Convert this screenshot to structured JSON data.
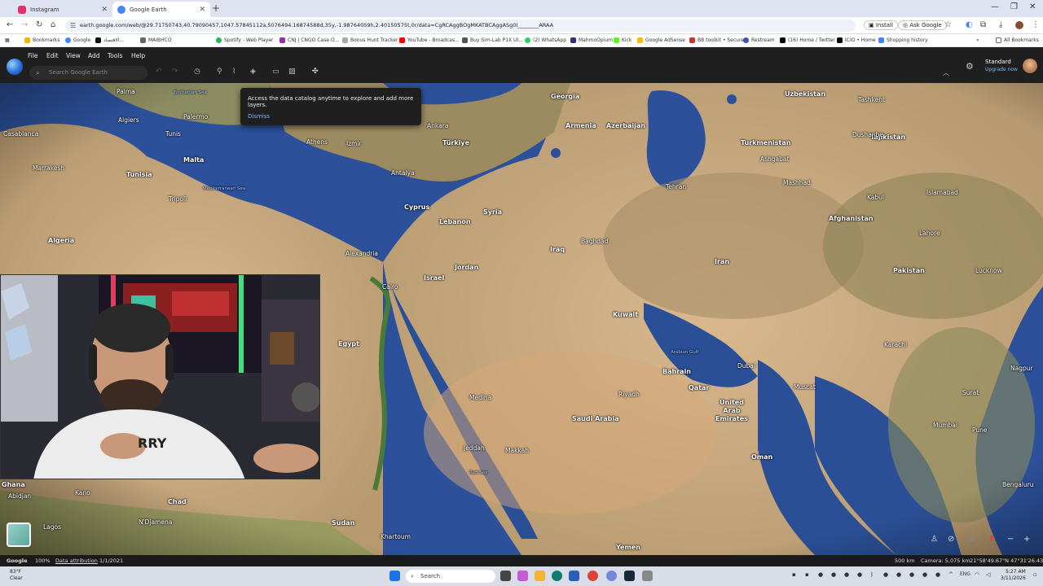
{
  "browser": {
    "tabs": [
      {
        "title": "Instagram",
        "color": "#e1306c"
      },
      {
        "title": "Google Earth",
        "color": "#4285f4"
      }
    ],
    "url": "earth.google.com/web/@29.71750743,40.79090457,1047.57845112a,5076494.16874588d,35y,-1.98764059h,2.40150575t,0r/data=CgRCAggBOgMKATBCAggASg0I________ARAA",
    "buttons": {
      "install": "Install",
      "ask_google": "Ask Google"
    },
    "bookmarks": [
      "Bookmarks",
      "Google",
      "الاقتصاد...",
      "MAIBHCO",
      "Spotify - Web Player",
      "CNJ | CNGO Case O...",
      "Bonus Hunt Tracker",
      "YouTube - Broadcas...",
      "Buy Sim-Lab P1X Ul...",
      "(2) WhatsApp",
      "MahmoOpium",
      "Kick",
      "Google AdSense",
      "BB toolkit • Secure",
      "Restream",
      "(16) Home / Twitter",
      "ICIO • Home",
      "Shopping history"
    ],
    "all_bookmarks": "All Bookmarks"
  },
  "earth": {
    "menu": [
      "File",
      "Edit",
      "View",
      "Add",
      "Tools",
      "Help"
    ],
    "search_placeholder": "Search Google Earth",
    "account": {
      "plan": "Standard",
      "upgrade": "Upgrade now"
    },
    "tooltip": {
      "text": "Access the data catalog anytime to explore and add more layers.",
      "dismiss": "Dismiss"
    },
    "labels": {
      "countries": [
        "Georgia",
        "Armenia",
        "Azerbaijan",
        "Uzbekistan",
        "Tajikistan",
        "Turkmenistan",
        "Türkiye",
        "Cyprus",
        "Lebanon",
        "Syria",
        "Iraq",
        "Iran",
        "Afghanistan",
        "Pakistan",
        "Malta",
        "Tunisia",
        "Algeria",
        "Egypt",
        "Israel",
        "Jordan",
        "Kuwait",
        "Bahrain",
        "Qatar",
        "United Arab Emirates",
        "Saudi Arabia",
        "Oman",
        "Yemen",
        "Sudan",
        "Chad",
        "Ghana"
      ],
      "cities": [
        "Palma",
        "Algiers",
        "Tunis",
        "Palermo",
        "Athens",
        "Izmir",
        "Ankara",
        "Antalya",
        "Tripoli",
        "Alexandria",
        "Cairo",
        "Baghdad",
        "Tehran",
        "Mashhad",
        "Kabul",
        "Islamabad",
        "Lahore",
        "Lucknow",
        "Karachi",
        "Muscat",
        "Dubai",
        "Riyadh",
        "Medina",
        "Jeddah",
        "Makkah",
        "Surat",
        "Mumbai",
        "Pune",
        "Nagpur",
        "Bengaluru",
        "Tashkent",
        "Dushanbe",
        "Ashgabat",
        "Casablanca",
        "Marrakesh",
        "Khartoum",
        "Kano",
        "Lagos",
        "Abidjan",
        "N'Djamena"
      ],
      "seas": [
        "Tyrrhenian Sea",
        "Mediterranean Sea",
        "Red Sea",
        "Arabian Gulf"
      ]
    },
    "status": {
      "brand": "Google",
      "zoom": "100%",
      "attribution": "Data attribution",
      "date": "1/1/2021",
      "scale": "500 km",
      "camera": "Camera: 5,075 km",
      "coords": "21°58'49.67\"N 47°31'26.43\"E"
    },
    "controls": {
      "three_d": "3D"
    }
  },
  "taskbar": {
    "weather_temp": "83°F",
    "weather_desc": "Clear",
    "search": "Search",
    "lang": "ENG",
    "time": "5:27 AM",
    "date": "3/11/2026"
  }
}
